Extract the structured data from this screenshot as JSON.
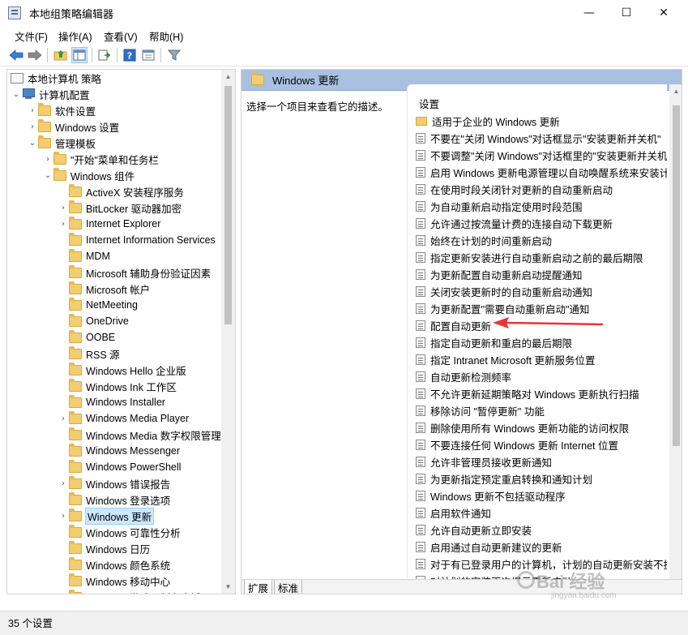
{
  "window": {
    "title": "本地组策略编辑器",
    "min_glyph": "—",
    "max_glyph": "☐",
    "close_glyph": "✕"
  },
  "menu": [
    "文件(F)",
    "操作(A)",
    "查看(V)",
    "帮助(H)"
  ],
  "toolbar": {
    "icons": [
      "back-icon",
      "forward-icon",
      "up-folder-icon",
      "show-hide-tree-icon",
      "export-list-icon",
      "help-icon",
      "properties-icon",
      "filter-icon"
    ]
  },
  "tree": {
    "root": "本地计算机 策略",
    "computer_config": "计算机配置",
    "software_settings": "软件设置",
    "windows_settings": "Windows 设置",
    "admin_templates": "管理模板",
    "start_menu": "\"开始\"菜单和任务栏",
    "windows_components": "Windows 组件",
    "components": [
      {
        "label": "ActiveX 安装程序服务",
        "expandable": false
      },
      {
        "label": "BitLocker 驱动器加密",
        "expandable": true
      },
      {
        "label": "Internet Explorer",
        "expandable": true
      },
      {
        "label": "Internet Information Services",
        "expandable": false
      },
      {
        "label": "MDM",
        "expandable": false
      },
      {
        "label": "Microsoft 辅助身份验证因素",
        "expandable": false
      },
      {
        "label": "Microsoft 帐户",
        "expandable": false
      },
      {
        "label": "NetMeeting",
        "expandable": false
      },
      {
        "label": "OneDrive",
        "expandable": false
      },
      {
        "label": "OOBE",
        "expandable": false
      },
      {
        "label": "RSS 源",
        "expandable": false
      },
      {
        "label": "Windows Hello 企业版",
        "expandable": false
      },
      {
        "label": "Windows Ink 工作区",
        "expandable": false
      },
      {
        "label": "Windows Installer",
        "expandable": false
      },
      {
        "label": "Windows Media Player",
        "expandable": true
      },
      {
        "label": "Windows Media 数字权限管理",
        "expandable": false
      },
      {
        "label": "Windows Messenger",
        "expandable": false
      },
      {
        "label": "Windows PowerShell",
        "expandable": false
      },
      {
        "label": "Windows 错误报告",
        "expandable": true
      },
      {
        "label": "Windows 登录选项",
        "expandable": false
      },
      {
        "label": "Windows 更新",
        "expandable": true,
        "selected": true
      },
      {
        "label": "Windows 可靠性分析",
        "expandable": false
      },
      {
        "label": "Windows 日历",
        "expandable": false
      },
      {
        "label": "Windows 颜色系统",
        "expandable": false
      },
      {
        "label": "Windows 移动中心",
        "expandable": false
      },
      {
        "label": "Windows 游戏录制和广播",
        "expandable": false
      }
    ]
  },
  "right_pane": {
    "header_title": "Windows 更新",
    "description_prompt": "选择一个项目来查看它的描述。",
    "column_header": "设置",
    "folder_item": "适用于企业的 Windows 更新",
    "policies": [
      "不要在\"关闭 Windows\"对话框显示\"安装更新并关机\"",
      "不要调整\"关闭 Windows\"对话框里的\"安装更新并关机\"",
      "启用 Windows 更新电源管理以自动唤醒系统来安装计",
      "在使用时段关闭针对更新的自动重新启动",
      "为自动重新启动指定使用时段范围",
      "允许通过按流量计费的连接自动下载更新",
      "始终在计划的时间重新启动",
      "指定更新安装进行自动重新启动之前的最后期限",
      "为更新配置自动重新启动提醒通知",
      "关闭安装更新时的自动重新启动通知",
      "为更新配置\"需要自动重新启动\"通知",
      "配置自动更新",
      "指定自动更新和重启的最后期限",
      "指定 Intranet Microsoft 更新服务位置",
      "自动更新检测频率",
      "不允许更新延期策略对 Windows 更新执行扫描",
      "移除访问 \"暂停更新\" 功能",
      "删除使用所有 Windows 更新功能的访问权限",
      "不要连接任何 Windows 更新 Internet 位置",
      "允许非管理员接收更新通知",
      "为更新指定预定重启转换和通知计划",
      "Windows 更新不包括驱动程序",
      "启用软件通知",
      "允许自动更新立即安装",
      "启用通过自动更新建议的更新",
      "对于有已登录用户的计算机，计划的自动更新安装不执",
      "对计划的安装再次提示重新启动"
    ],
    "tabs": [
      "扩展",
      "标准"
    ]
  },
  "status": {
    "text": "35 个设置"
  },
  "watermark": {
    "main": "Bai 经验",
    "sub": "jingyan.baidu.com"
  },
  "colors": {
    "header_bg": "#a9c0e0",
    "selection": "#cce8ff",
    "arrow": "#e8343a"
  }
}
